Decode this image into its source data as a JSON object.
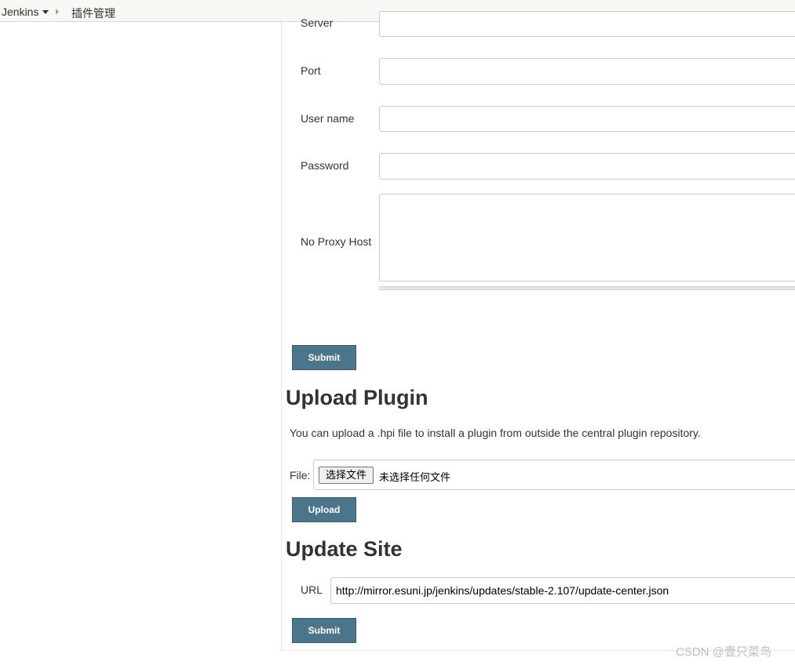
{
  "breadcrumb": {
    "home_label": "Jenkins",
    "current_label": "插件管理"
  },
  "proxy": {
    "server_label": "Server",
    "port_label": "Port",
    "username_label": "User name",
    "password_label": "Password",
    "no_proxy_label": "No Proxy Host",
    "server_value": "",
    "port_value": "",
    "username_value": "",
    "password_value": "",
    "no_proxy_value": "",
    "submit_label": "Submit"
  },
  "upload": {
    "heading": "Upload Plugin",
    "description": "You can upload a .hpi file to install a plugin from outside the central plugin repository.",
    "file_label": "File:",
    "choose_button": "选择文件",
    "file_status": "未选择任何文件",
    "upload_label": "Upload"
  },
  "update_site": {
    "heading": "Update Site",
    "url_label": "URL",
    "url_value": "http://mirror.esuni.jp/jenkins/updates/stable-2.107/update-center.json",
    "submit_label": "Submit"
  },
  "watermark": "CSDN @壹只菜鸟",
  "colors": {
    "button_bg": "#4b758b",
    "breadcrumb_bg": "#f7f7f4"
  }
}
